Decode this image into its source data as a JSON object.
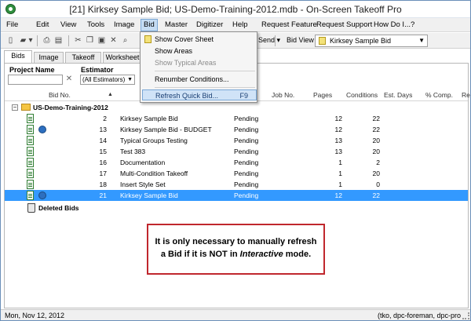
{
  "window": {
    "title": "[21] Kirksey Sample Bid; US-Demo-Training-2012.mdb - On-Screen Takeoff Pro"
  },
  "menubar": {
    "items": [
      "File",
      "Edit",
      "View",
      "Tools",
      "Image",
      "Bid",
      "Master",
      "Digitizer",
      "Help",
      "Request Feature",
      "Request Support",
      "How Do I...?"
    ]
  },
  "toolbar": {
    "send_label": "Send",
    "bidview_label": "Bid View",
    "bidview_value": "Kirksey Sample Bid"
  },
  "bid_menu": {
    "items": [
      {
        "label": "Show Cover Sheet",
        "enabled": true
      },
      {
        "label": "Show Areas",
        "enabled": true
      },
      {
        "label": "Show Typical Areas",
        "enabled": false
      },
      {
        "label": "Renumber Conditions...",
        "enabled": true
      },
      {
        "label": "Refresh Quick Bid...",
        "shortcut": "F9",
        "enabled": true,
        "highlighted": true
      }
    ]
  },
  "tabs": [
    "Bids",
    "Image",
    "Takeoff",
    "Worksheet"
  ],
  "active_tab": "Bids",
  "filters": {
    "project_name_label": "Project Name",
    "project_name_value": "",
    "estimator_label": "Estimator",
    "estimator_value": "(All Estimators)"
  },
  "columns": [
    "Bid No.",
    "Job No.",
    "Pages",
    "Conditions",
    "Est. Days",
    "% Comp.",
    "Re"
  ],
  "project": {
    "name": "US-Demo-Training-2012",
    "bids": [
      {
        "no": "2",
        "name": "Kirksey Sample Bid",
        "status": "Pending",
        "pages": "12",
        "conditions": "22",
        "web": false,
        "selected": false
      },
      {
        "no": "13",
        "name": "Kirksey Sample Bid - BUDGET",
        "status": "Pending",
        "pages": "12",
        "conditions": "22",
        "web": true,
        "selected": false
      },
      {
        "no": "14",
        "name": "Typical Groups Testing",
        "status": "Pending",
        "pages": "13",
        "conditions": "20",
        "web": false,
        "selected": false
      },
      {
        "no": "15",
        "name": "Test 383",
        "status": "Pending",
        "pages": "13",
        "conditions": "20",
        "web": false,
        "selected": false
      },
      {
        "no": "16",
        "name": "Documentation",
        "status": "Pending",
        "pages": "1",
        "conditions": "2",
        "web": false,
        "selected": false
      },
      {
        "no": "17",
        "name": "Multi-Condition Takeoff",
        "status": "Pending",
        "pages": "1",
        "conditions": "20",
        "web": false,
        "selected": false
      },
      {
        "no": "18",
        "name": "Insert Style Set",
        "status": "Pending",
        "pages": "1",
        "conditions": "0",
        "web": false,
        "selected": false
      },
      {
        "no": "21",
        "name": "Kirksey Sample Bid",
        "status": "Pending",
        "pages": "12",
        "conditions": "22",
        "web": true,
        "selected": true
      }
    ],
    "deleted_label": "Deleted Bids"
  },
  "callout": {
    "line1": "It is only necessary to manually refresh",
    "line2_pre": "a Bid if it is NOT in ",
    "line2_em": "Interactive",
    "line2_post": " mode."
  },
  "statusbar": {
    "date": "Mon, Nov 12, 2012",
    "user": "(tko, dpc-foreman, dpc-pro"
  },
  "colors": {
    "selection": "#3399ff",
    "menu_highlight": "#d0e3f7",
    "callout_border": "#c0272d"
  }
}
